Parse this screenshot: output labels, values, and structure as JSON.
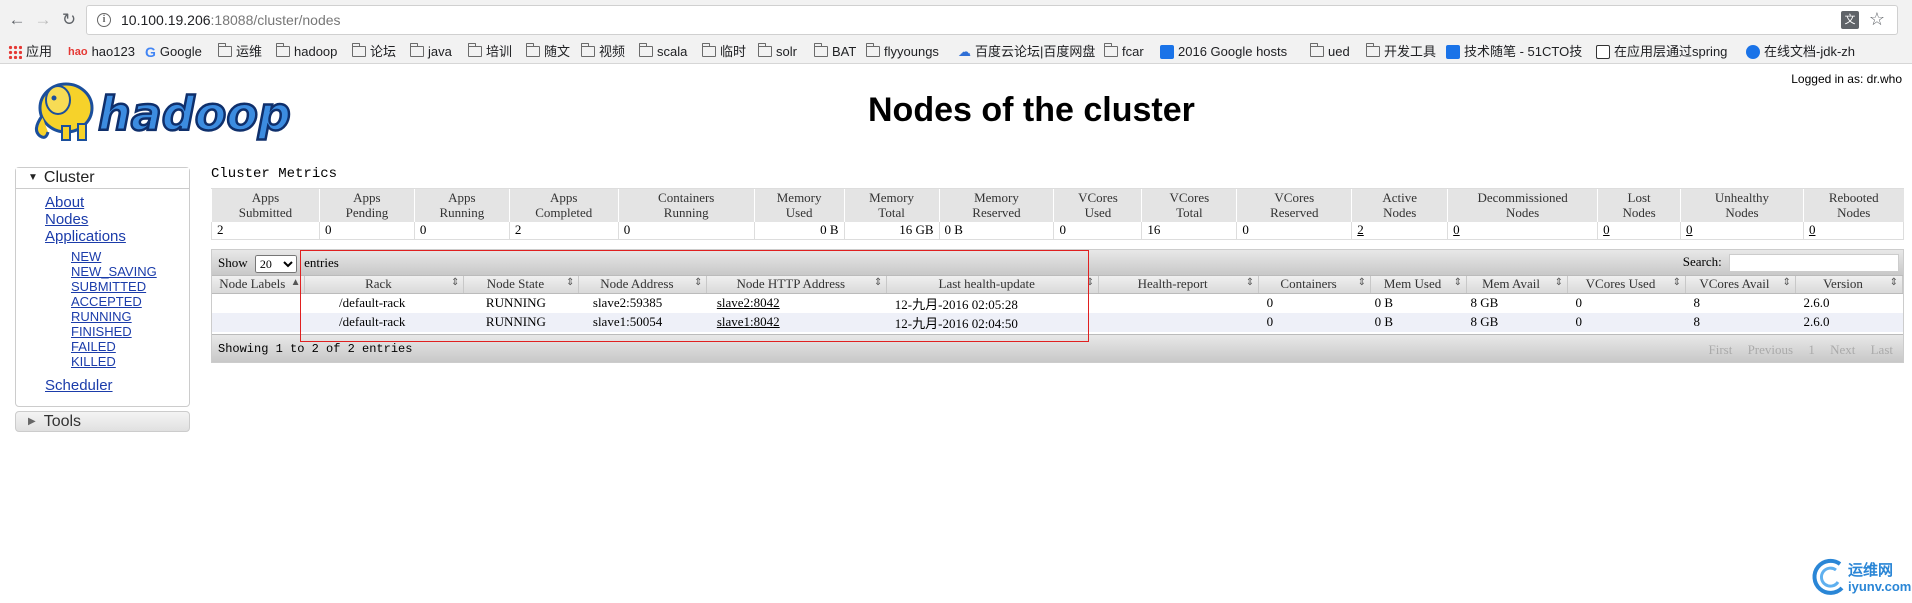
{
  "browser": {
    "url_host": "10.100.19.206",
    "url_path": ":18088/cluster/nodes",
    "back_icon": "back-arrow-icon",
    "forward_icon": "forward-arrow-icon",
    "reload_icon": "reload-icon",
    "translate_label": "文",
    "bookmarks": [
      {
        "label": "应用",
        "icon": "apps-grid-icon"
      },
      {
        "label": "hao123",
        "icon": "hao123-icon"
      },
      {
        "label": "Google",
        "icon": "google-icon"
      },
      {
        "label": "运维",
        "icon": "folder-icon"
      },
      {
        "label": "hadoop",
        "icon": "folder-icon"
      },
      {
        "label": "论坛",
        "icon": "folder-icon"
      },
      {
        "label": "java",
        "icon": "folder-icon"
      },
      {
        "label": "培训",
        "icon": "folder-icon"
      },
      {
        "label": "随文",
        "icon": "folder-icon"
      },
      {
        "label": "视频",
        "icon": "folder-icon"
      },
      {
        "label": "scala",
        "icon": "folder-icon"
      },
      {
        "label": "临时",
        "icon": "folder-icon"
      },
      {
        "label": "solr",
        "icon": "folder-icon"
      },
      {
        "label": "BAT",
        "icon": "folder-icon"
      },
      {
        "label": "flyyoungs",
        "icon": "folder-icon"
      },
      {
        "label": "百度云论坛|百度网盘",
        "icon": "baidu-cloud-icon"
      },
      {
        "label": "fcar",
        "icon": "folder-icon"
      },
      {
        "label": "2016 Google hosts",
        "icon": "page-icon"
      },
      {
        "label": "ued",
        "icon": "folder-icon"
      },
      {
        "label": "开发工具",
        "icon": "folder-icon"
      },
      {
        "label": "技术随笔 - 51CTO技",
        "icon": "page-icon"
      },
      {
        "label": "在应用层通过spring",
        "icon": "page-icon"
      },
      {
        "label": "在线文档-jdk-zh",
        "icon": "page-icon"
      }
    ]
  },
  "header": {
    "logo_text": "hadoop",
    "logged_in": "Logged in as: dr.who",
    "title": "Nodes of the cluster"
  },
  "sidebar": {
    "cluster_label": "Cluster",
    "links": [
      "About",
      "Nodes",
      "Applications"
    ],
    "app_states": [
      "NEW",
      "NEW_SAVING",
      "SUBMITTED",
      "ACCEPTED",
      "RUNNING",
      "FINISHED",
      "FAILED",
      "KILLED"
    ],
    "scheduler": "Scheduler",
    "tools_label": "Tools"
  },
  "metrics": {
    "title": "Cluster Metrics",
    "headers": [
      [
        "Apps",
        "Submitted"
      ],
      [
        "Apps",
        "Pending"
      ],
      [
        "Apps",
        "Running"
      ],
      [
        "Apps",
        "Completed"
      ],
      [
        "Containers",
        "Running"
      ],
      [
        "Memory",
        "Used"
      ],
      [
        "Memory",
        "Total"
      ],
      [
        "Memory",
        "Reserved"
      ],
      [
        "VCores",
        "Used"
      ],
      [
        "VCores",
        "Total"
      ],
      [
        "VCores",
        "Reserved"
      ],
      [
        "Active",
        "Nodes"
      ],
      [
        "Decommissioned",
        "Nodes"
      ],
      [
        "Lost",
        "Nodes"
      ],
      [
        "Unhealthy",
        "Nodes"
      ],
      [
        "Rebooted",
        "Nodes"
      ]
    ],
    "values": [
      "2",
      "0",
      "0",
      "2",
      "0",
      "0 B",
      "16 GB",
      "0 B",
      "0",
      "16",
      "0",
      "2",
      "0",
      "0",
      "0",
      "0"
    ]
  },
  "nodes_table": {
    "show_label": "Show",
    "entries_label": "entries",
    "page_size": "20",
    "search_label": "Search:",
    "columns": [
      "Node Labels",
      "Rack",
      "Node State",
      "Node Address",
      "Node HTTP Address",
      "Last health-update",
      "Health-report",
      "Containers",
      "Mem Used",
      "Mem Avail",
      "VCores Used",
      "VCores Avail",
      "Version"
    ],
    "rows": [
      {
        "labels": "",
        "rack": "/default-rack",
        "state": "RUNNING",
        "address": "slave2:59385",
        "http": "slave2:8042",
        "health_update": "12-九月-2016 02:05:28",
        "health_report": "",
        "containers": "0",
        "mem_used": "0 B",
        "mem_avail": "8 GB",
        "vcores_used": "0",
        "vcores_avail": "8",
        "version": "2.6.0"
      },
      {
        "labels": "",
        "rack": "/default-rack",
        "state": "RUNNING",
        "address": "slave1:50054",
        "http": "slave1:8042",
        "health_update": "12-九月-2016 02:04:50",
        "health_report": "",
        "containers": "0",
        "mem_used": "0 B",
        "mem_avail": "8 GB",
        "vcores_used": "0",
        "vcores_avail": "8",
        "version": "2.6.0"
      }
    ],
    "info": "Showing 1 to 2 of 2 entries",
    "pager": [
      "First",
      "Previous",
      "1",
      "Next",
      "Last"
    ]
  },
  "watermark": {
    "line1": "运维网",
    "line2": "iyunv.com"
  },
  "colors": {
    "link": "#1b3caa",
    "annotation_red": "#e02020",
    "even_row": "#eef0f8",
    "header_gray": "#e4e4e4",
    "logo_yellow": "#f6d22a",
    "logo_blue": "#1b4f9c"
  }
}
